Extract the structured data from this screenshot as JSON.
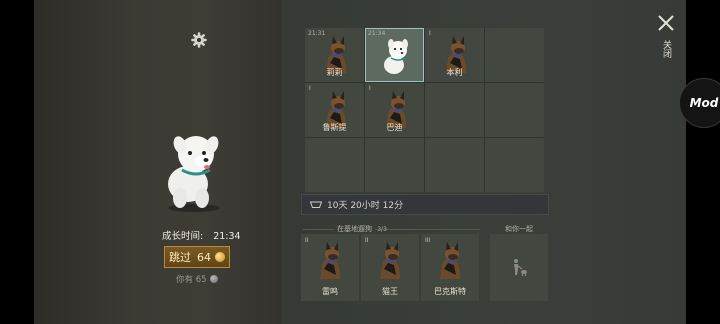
{
  "left_panel": {
    "growth_label": "成长时间:",
    "growth_time": "21:34",
    "skip_button": {
      "label": "跳过",
      "cost": "64"
    },
    "have_text": "你有 65"
  },
  "breeding_grid": {
    "slots": [
      {
        "name": "莉莉",
        "time": "21:31",
        "breed": "shepherd",
        "selected": false
      },
      {
        "name": "",
        "time": "21:34",
        "breed": "white-puppy",
        "selected": true
      },
      {
        "name": "本利",
        "rank": "I",
        "breed": "shepherd",
        "selected": false
      },
      {
        "name": "",
        "empty": true
      },
      {
        "name": "鲁斯提",
        "rank": "I",
        "breed": "shepherd",
        "selected": false
      },
      {
        "name": "巴迪",
        "rank": "I",
        "breed": "shepherd",
        "selected": false
      }
    ]
  },
  "timer": {
    "text": "10天 20小时 12分"
  },
  "base": {
    "label": "在基地遛狗",
    "count": "3/3",
    "dogs": [
      {
        "name": "雷鸣",
        "rank": "II"
      },
      {
        "name": "猫王",
        "rank": "II"
      },
      {
        "name": "巴克斯特",
        "rank": "III"
      }
    ],
    "together_label": "和你一起"
  },
  "top_right": {
    "close_label": "关闭"
  },
  "overlay": {
    "mod_label": "Mod"
  },
  "icons": [
    "gear-icon",
    "coin-icon",
    "bowl-icon",
    "close-icon",
    "walker-icon"
  ]
}
